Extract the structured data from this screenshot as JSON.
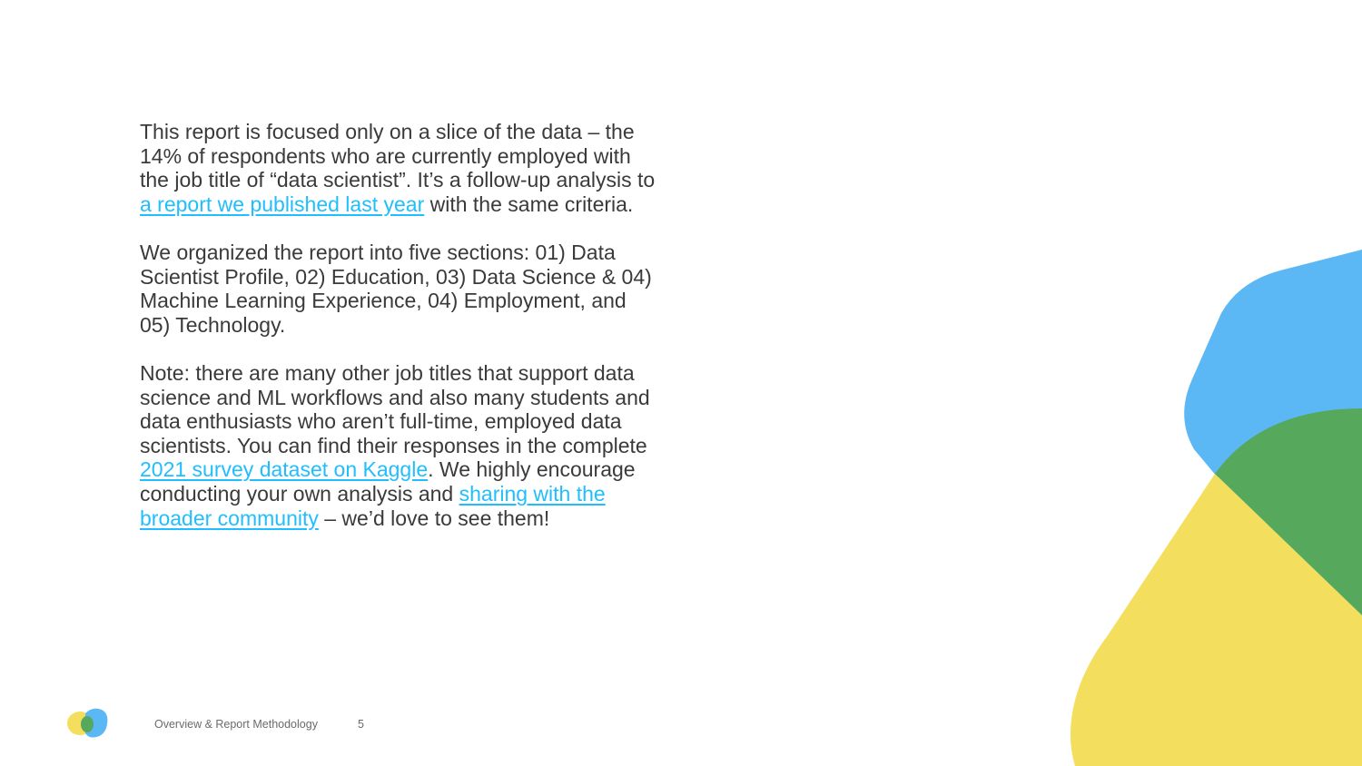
{
  "paragraphs": {
    "p1": {
      "text_a": "This report is focused only on a slice of the data – the 14% of respondents who are currently employed with the job title of “data scientist”. It’s a follow-up analysis to ",
      "link": "a report we published last year",
      "text_b": " with the same criteria."
    },
    "p2": {
      "text": "We organized the report into five sections: 01) Data Scientist Profile, 02) Education, 03) Data Science & 04) Machine Learning Experience, 04) Employment, and 05) Technology."
    },
    "p3": {
      "text_a": "Note: there are many other job titles that support data science and ML workflows and also many students and data enthusiasts who aren’t full-time, employed data scientists. You can find their responses in the complete ",
      "link1": "2021 survey dataset on Kaggle",
      "text_b": ". We highly encourage conducting your own analysis and ",
      "link2": "sharing with the broader community",
      "text_c": " – we’d love to see them!"
    }
  },
  "footer": {
    "section": "Overview & Report Methodology",
    "page_number": "5"
  },
  "colors": {
    "link": "#20beff",
    "blue": "#5bb8f5",
    "green": "#56a85c",
    "yellow": "#f3de5e"
  }
}
